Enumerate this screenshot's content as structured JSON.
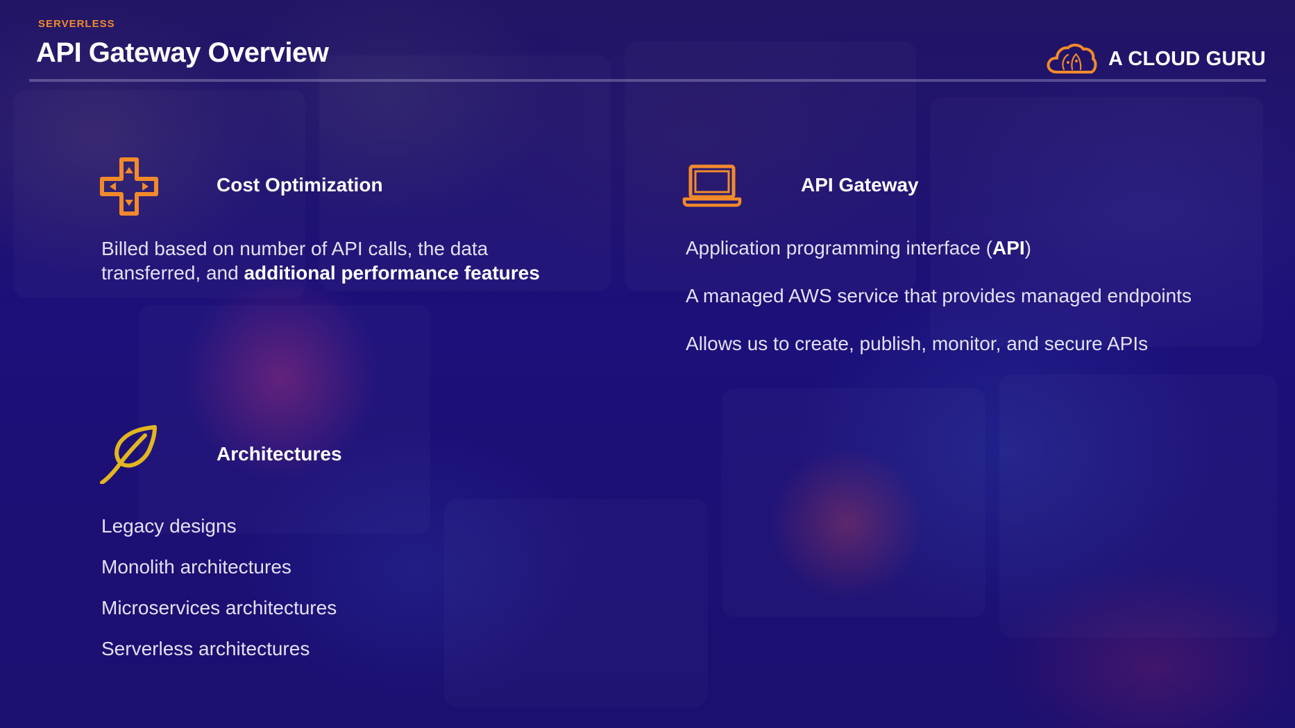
{
  "header": {
    "kicker": "SERVERLESS",
    "title": "API Gateway Overview"
  },
  "brand": {
    "logo_icon": "cloud-logo-icon",
    "name": "A CLOUD GURU"
  },
  "colors": {
    "accent_orange": "#f28a2b",
    "accent_yellow": "#e2b620",
    "background": "#1a0f6b",
    "text": "#ffffff"
  },
  "cost": {
    "icon": "directional-pad-icon",
    "title": "Cost Optimization",
    "text_plain": "Billed based on number of API calls, the data transferred, and ",
    "text_bold": "additional performance features"
  },
  "api_gateway": {
    "icon": "laptop-icon",
    "title": "API Gateway",
    "line1_plain": "Application programming interface (",
    "line1_bold": "API",
    "line1_end": ")",
    "line2": "A managed AWS service that provides managed endpoints",
    "line3": "Allows us to create, publish, monitor, and secure APIs"
  },
  "architectures": {
    "icon": "feather-icon",
    "title": "Architectures",
    "items": [
      "Legacy designs",
      "Monolith architectures",
      "Microservices architectures",
      "Serverless architectures"
    ]
  }
}
